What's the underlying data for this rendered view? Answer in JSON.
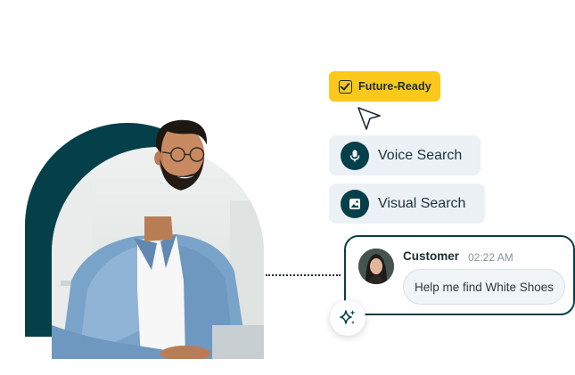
{
  "badge": {
    "label": "Future-Ready",
    "icon": "checkbox-icon",
    "color": "#fbc81b"
  },
  "search_options": [
    {
      "label": "Voice Search",
      "icon": "microphone-icon"
    },
    {
      "label": "Visual Search",
      "icon": "image-icon"
    }
  ],
  "chat": {
    "sender": "Customer",
    "time": "02:22 AM",
    "message": "Help me find White Shoes",
    "avatar": "avatar-image"
  },
  "ai_button": {
    "icon": "sparkle-icon"
  },
  "colors": {
    "accent_dark": "#05404a",
    "pill_bg": "#ecf1f6",
    "badge": "#fbc81b"
  }
}
